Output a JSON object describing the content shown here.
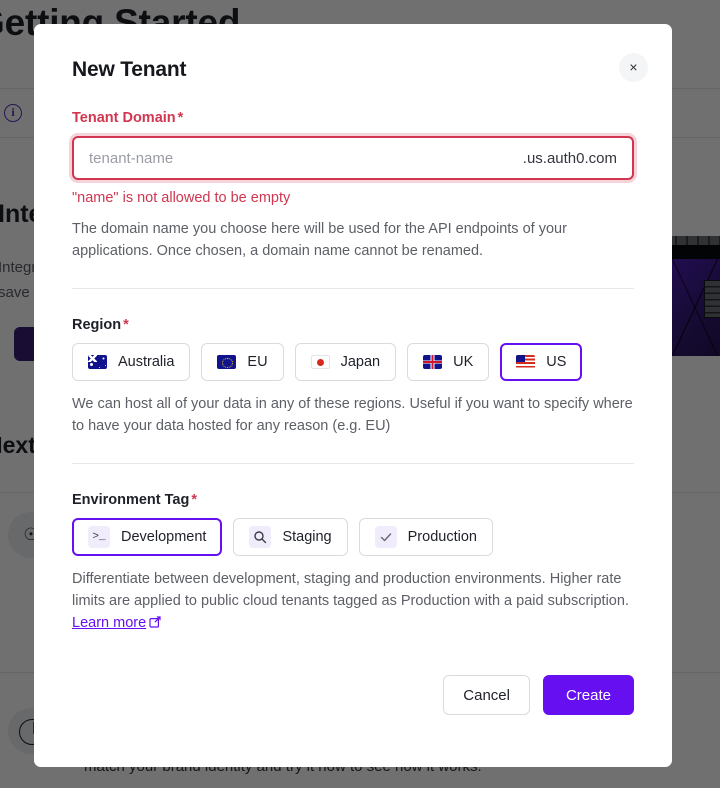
{
  "background": {
    "page_title": "Getting Started",
    "banner_icon": "info-circle-icon",
    "section_heading": "Integrations",
    "section_paragraph_line1": "Integrate your app with third-party services and",
    "section_paragraph_line2": "save time building from scratch.",
    "next_steps_heading": "Next Steps",
    "bottom_text": "match your brand identity and try it now to see how it works.",
    "list_glyph_1": "user-icon",
    "list_glyph_2": "shield-icon"
  },
  "modal": {
    "title": "New Tenant",
    "close_label": "×",
    "close_icon": "close-icon",
    "domain": {
      "label": "Tenant Domain",
      "required_mark": "*",
      "placeholder": "tenant-name",
      "value": "",
      "suffix": ".us.auth0.com",
      "error": "\"name\" is not allowed to be empty",
      "help": "The domain name you choose here will be used for the API endpoints of your applications. Once chosen, a domain name cannot be renamed."
    },
    "region": {
      "label": "Region",
      "required_mark": "*",
      "options": [
        {
          "label": "Australia",
          "icon": "flag-australia-icon",
          "selected": false
        },
        {
          "label": "EU",
          "icon": "flag-eu-icon",
          "selected": false
        },
        {
          "label": "Japan",
          "icon": "flag-japan-icon",
          "selected": false
        },
        {
          "label": "UK",
          "icon": "flag-uk-icon",
          "selected": false
        },
        {
          "label": "US",
          "icon": "flag-us-icon",
          "selected": true
        }
      ],
      "selected_value": "US",
      "help": "We can host all of your data in any of these regions. Useful if you want to specify where to have your data hosted for any reason (e.g. EU)"
    },
    "environment": {
      "label": "Environment Tag",
      "required_mark": "*",
      "options": [
        {
          "label": "Development",
          "icon": "terminal-prompt-icon",
          "selected": true
        },
        {
          "label": "Staging",
          "icon": "magnifier-icon",
          "selected": false
        },
        {
          "label": "Production",
          "icon": "check-icon",
          "selected": false
        }
      ],
      "selected_value": "Development",
      "help_part1": "Differentiate between development, staging and production environments. Higher rate limits are applied to public cloud tenants tagged as Production with a paid subscription. ",
      "learn_more": "Learn more",
      "learn_more_icon": "external-link-icon"
    },
    "footer": {
      "cancel_label": "Cancel",
      "create_label": "Create"
    }
  },
  "colors": {
    "accent": "#6610f2",
    "error": "#d0364f",
    "text": "#1e212a",
    "muted": "#5c5f66",
    "scrim": "rgba(0,0,0,0.56)"
  }
}
